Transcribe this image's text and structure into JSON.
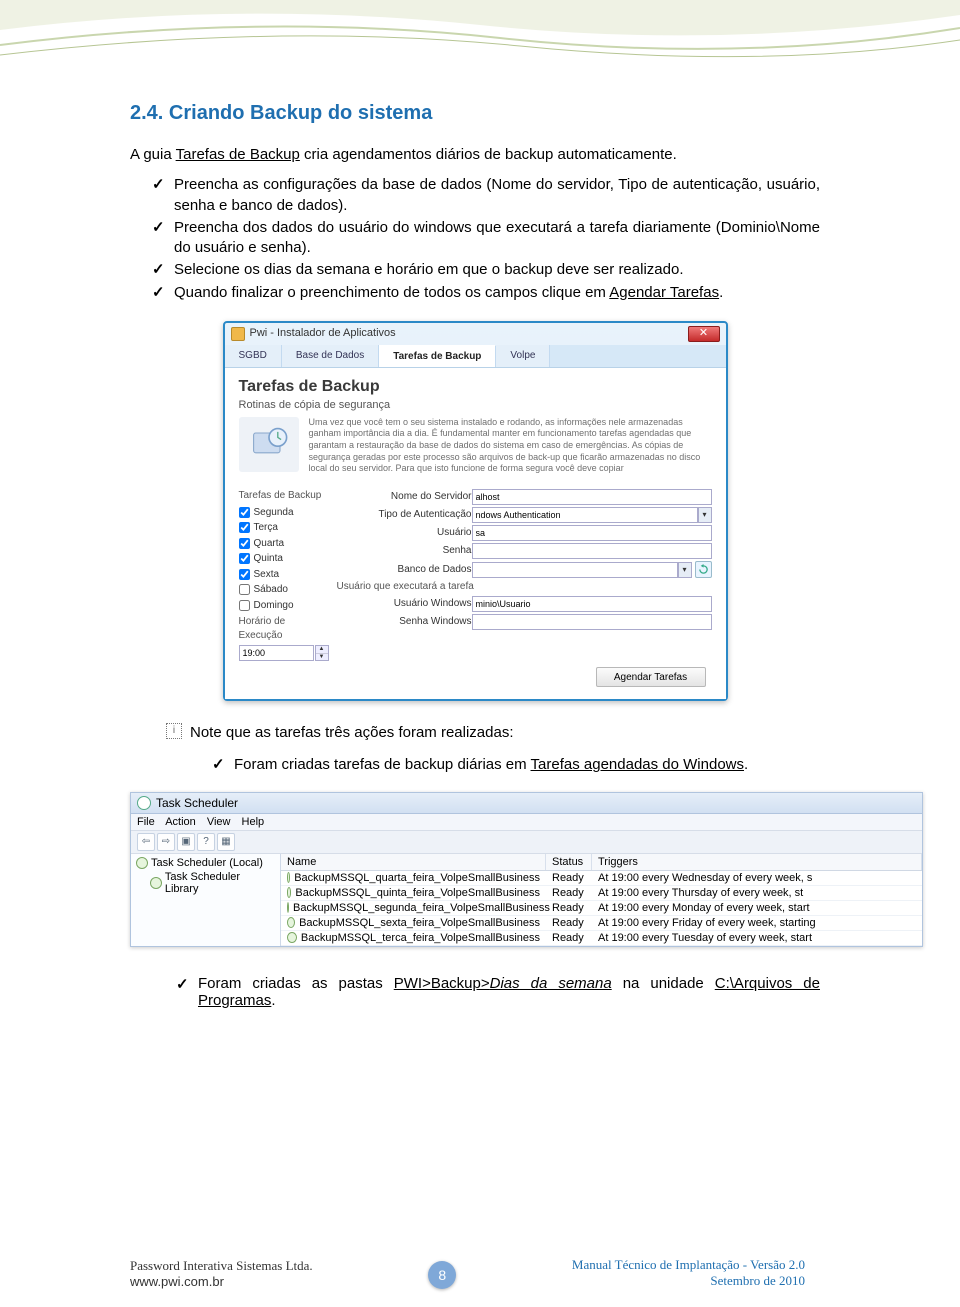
{
  "heading": "2.4.    Criando Backup do sistema",
  "intro_parts": {
    "a": "A guia ",
    "u1": "Tarefas de Backup",
    "b": " cria agendamentos diários de backup automaticamente."
  },
  "bullets": [
    "Preencha as configurações da base de dados (Nome do servidor, Tipo de autenticação, usuário, senha e banco de dados).",
    "Preencha dos dados do usuário do windows que executará a tarefa diariamente (Dominio\\Nome do usuário e senha).",
    "Selecione os dias da semana e horário em que o backup deve ser realizado."
  ],
  "bullet4": {
    "a": "Quando finalizar o preenchimento de todos os campos clique em ",
    "u": "Agendar Tarefas",
    "b": "."
  },
  "installer": {
    "title": "Pwi - Instalador de Aplicativos",
    "tabs": [
      "SGBD",
      "Base de Dados",
      "Tarefas de Backup",
      "Volpe"
    ],
    "panel_title": "Tarefas de Backup",
    "panel_sub": "Rotinas de cópia de segurança",
    "panel_desc": "Uma vez que você tem o seu sistema instalado e rodando, as informações nele armazenadas ganham importância dia a dia. É fundamental manter em funcionamento tarefas agendadas que garantam a restauração da base de dados do sistema em caso de emergências.\nAs cópias de segurança geradas por este processo são arquivos de back-up que ficarão armazenadas no disco local do seu servidor. Para que isto funcione de forma segura você deve copiar",
    "days_header": "Tarefas de Backup",
    "days": [
      {
        "label": "Segunda",
        "checked": true
      },
      {
        "label": "Terça",
        "checked": true
      },
      {
        "label": "Quarta",
        "checked": true
      },
      {
        "label": "Quinta",
        "checked": true
      },
      {
        "label": "Sexta",
        "checked": true
      },
      {
        "label": "Sábado",
        "checked": false
      },
      {
        "label": "Domingo",
        "checked": false
      }
    ],
    "time_label": "Horário de Execução",
    "time_value": "19:00",
    "fields": [
      {
        "label": "Nome do Servidor",
        "value": "alhost",
        "type": "text"
      },
      {
        "label": "Tipo de Autenticação",
        "value": "ndows Authentication",
        "type": "dropdown"
      },
      {
        "label": "Usuário",
        "value": "sa",
        "type": "text"
      },
      {
        "label": "Senha",
        "value": "",
        "type": "text"
      },
      {
        "label": "Banco de Dados",
        "value": "",
        "type": "dropdown_refresh"
      },
      {
        "label": "Usuário que executará a tarefa",
        "value": "",
        "type": "label"
      },
      {
        "label": "Usuário Windows",
        "value": "minio\\Usuario",
        "type": "text"
      },
      {
        "label": "Senha Windows",
        "value": "",
        "type": "text"
      }
    ],
    "schedule_btn": "Agendar Tarefas"
  },
  "note_text": "Note que as tarefas três ações foram realizadas:",
  "note_check": {
    "a": "Foram criadas tarefas de backup diárias em ",
    "u": "Tarefas agendadas do Windows",
    "b": "."
  },
  "task_scheduler": {
    "title": "Task Scheduler",
    "menu": [
      "File",
      "Action",
      "View",
      "Help"
    ],
    "tree": [
      {
        "label": "Task Scheduler (Local)",
        "child": false
      },
      {
        "label": "Task Scheduler Library",
        "child": true
      }
    ],
    "columns": [
      "Name",
      "Status",
      "Triggers"
    ],
    "rows": [
      {
        "name": "BackupMSSQL_quarta_feira_VolpeSmallBusiness",
        "status": "Ready",
        "trigger": "At 19:00 every Wednesday of every week, s"
      },
      {
        "name": "BackupMSSQL_quinta_feira_VolpeSmallBusiness",
        "status": "Ready",
        "trigger": "At 19:00 every Thursday of every week, st"
      },
      {
        "name": "BackupMSSQL_segunda_feira_VolpeSmallBusiness",
        "status": "Ready",
        "trigger": "At 19:00 every Monday of every week, start"
      },
      {
        "name": "BackupMSSQL_sexta_feira_VolpeSmallBusiness",
        "status": "Ready",
        "trigger": "At 19:00 every Friday of every week, starting"
      },
      {
        "name": "BackupMSSQL_terca_feira_VolpeSmallBusiness",
        "status": "Ready",
        "trigger": "At 19:00 every Tuesday of every week, start"
      }
    ]
  },
  "last_check": {
    "a": "Foram criadas  as pastas ",
    "u": "PWI>Backup>",
    "i": "Dias da semana",
    "b": " na unidade ",
    "u2": "C:\\Arquivos de Programas",
    "c": "."
  },
  "footer": {
    "left1": "Password Interativa Sistemas Ltda.",
    "left2": "www.pwi.com.br",
    "page": "8",
    "right1": "Manual Técnico de Implantação - Versão 2.0",
    "right2": "Setembro de 2010"
  }
}
